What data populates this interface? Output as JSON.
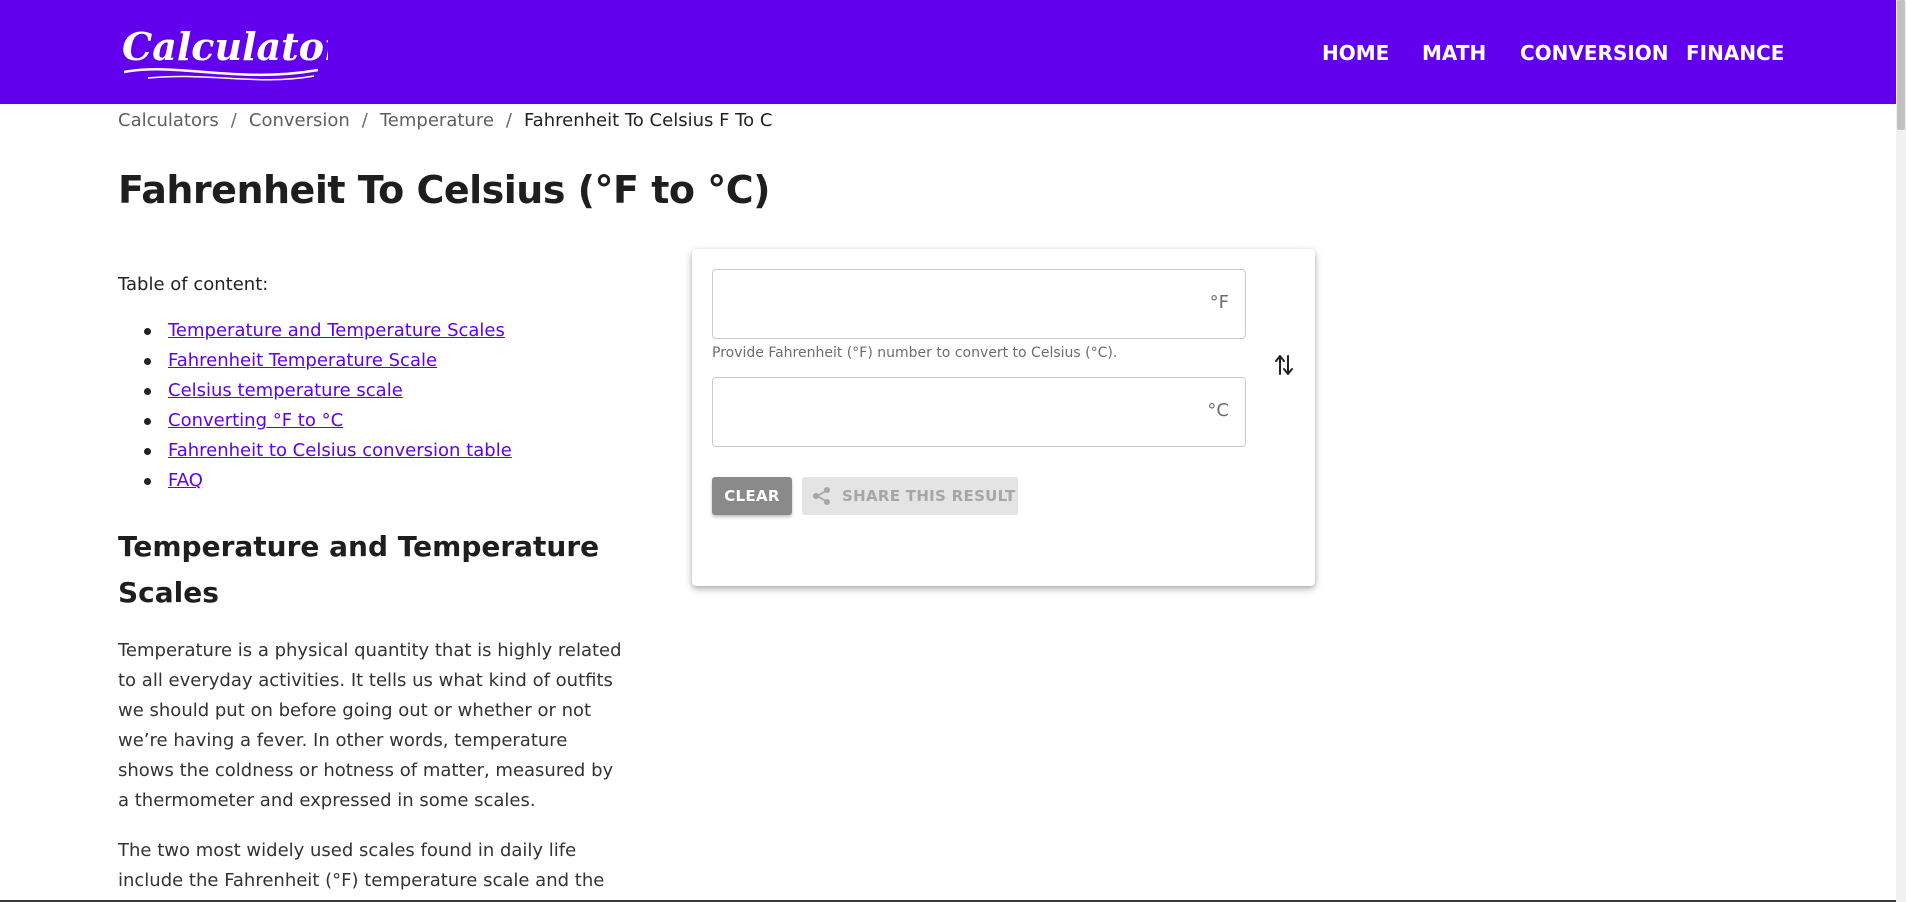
{
  "header": {
    "logo_text": "Calculatorful",
    "nav": {
      "home": "HOME",
      "math": "MATH",
      "conversion": "CONVERSION",
      "finance": "FINANCE"
    },
    "brand_color": "#6200ee"
  },
  "breadcrumb": {
    "items": [
      "Calculators",
      "Conversion",
      "Temperature",
      "Fahrenheit To Celsius F To C"
    ],
    "separator": "/"
  },
  "page": {
    "title": "Fahrenheit To Celsius (°F to °C)"
  },
  "toc": {
    "label": "Table of content:",
    "items": [
      "Temperature and Temperature Scales",
      "Fahrenheit Temperature Scale",
      "Celsius temperature scale",
      "Converting °F to °C ",
      "Fahrenheit to Celsius conversion table",
      "FAQ"
    ]
  },
  "article": {
    "heading": "Temperature and Temperature Scales",
    "paragraphs": [
      "Temperature is a physical quantity that is highly related to all everyday activities. It tells us what kind of outfits we should put on before going out or whether or not we’re having a fever. In other words, temperature shows the coldness or hotness of matter, measured by a thermometer and expressed in some scales.",
      "The two most widely used scales found in daily life include the Fahrenheit (°F) temperature scale and the"
    ]
  },
  "calculator": {
    "fahrenheit": {
      "value": "",
      "unit": "°F"
    },
    "hint": "Provide Fahrenheit (°F) number to convert to Celsius (°C).",
    "celsius": {
      "value": "",
      "unit": "°C"
    },
    "clear_label": "CLEAR",
    "share_label": "SHARE THIS RESULT",
    "icons": {
      "swap": "swap-vertical-icon",
      "share": "share-icon"
    }
  }
}
